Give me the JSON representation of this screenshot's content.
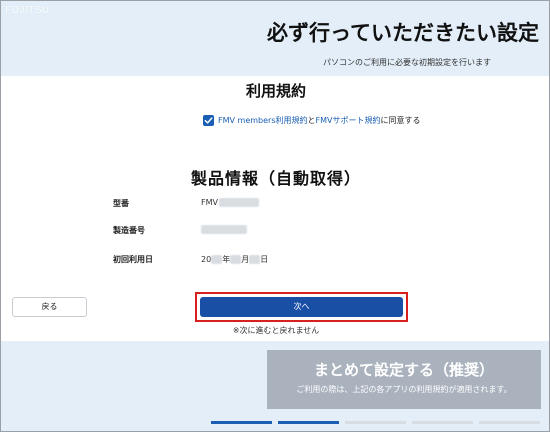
{
  "header": {
    "brand": "FUJITSU",
    "title": "必ず行っていただきたい設定",
    "subtitle": "パソコンのご利用に必要な初期設定を行います"
  },
  "terms": {
    "heading": "利用規約",
    "checked": true,
    "link1": "FMV members利用規約",
    "connector": "と",
    "link2": "FMVサポート規約",
    "suffix": "に同意する"
  },
  "product": {
    "heading": "製品情報（自動取得）",
    "model_label": "型番",
    "model_value": "FMV",
    "serial_label": "製造番号",
    "date_label": "初回利用日",
    "date_prefix": "20",
    "date_year": "年",
    "date_month": "月",
    "date_day": "日"
  },
  "actions": {
    "back_label": "戻る",
    "next_label": "次へ",
    "next_note": "※次に進むと戻れません"
  },
  "recommend": {
    "title": "まとめて設定する（推奨）",
    "note": "ご利用の際は、上記の各アプリの利用規約が適用されます。"
  },
  "progress": {
    "total_steps": 5,
    "completed_steps": 2
  },
  "colors": {
    "accent": "#1a5fb4",
    "highlight": "#d9201e",
    "band": "#e3eef8",
    "panel": "#a9b2bd"
  }
}
